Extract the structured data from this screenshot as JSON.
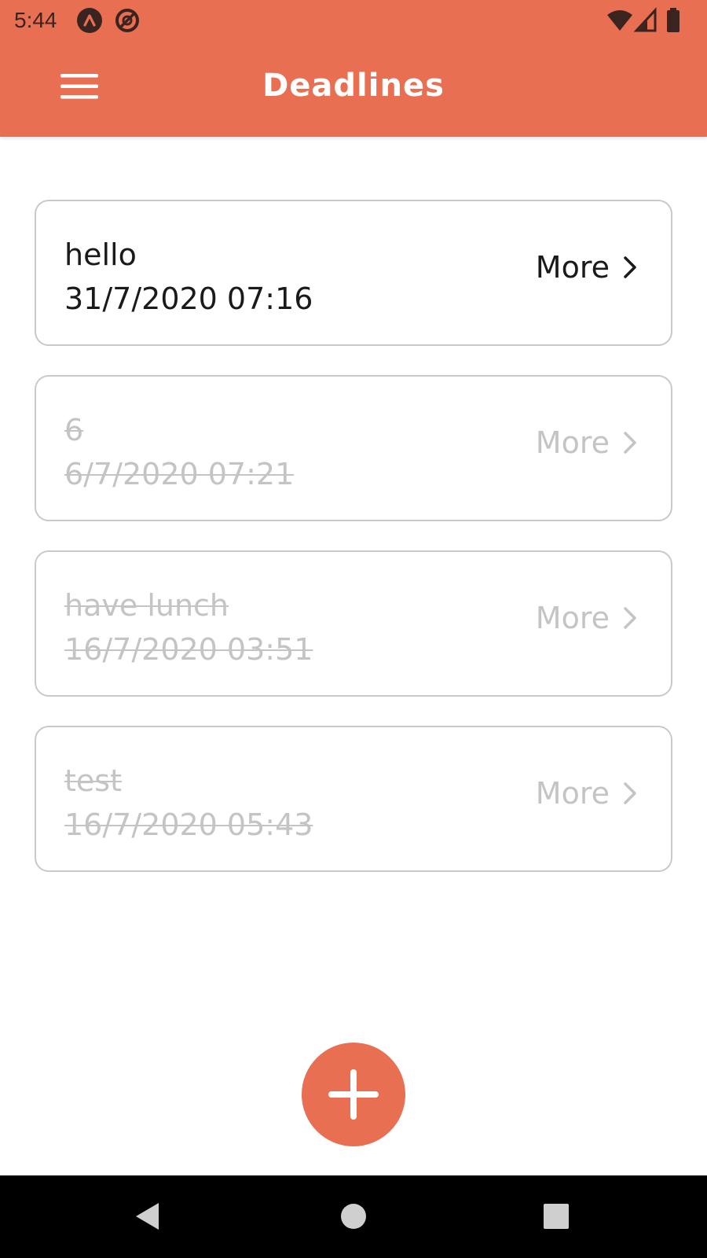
{
  "status_bar": {
    "time": "5:44",
    "left_icons": [
      "notification-app-icon",
      "notification-sync-icon"
    ],
    "right_icons": [
      "wifi-icon",
      "signal-icon",
      "battery-icon"
    ]
  },
  "app_bar": {
    "title": "Deadlines",
    "menu_icon": "hamburger-menu-icon"
  },
  "deadlines": [
    {
      "title": "hello",
      "date": "31/7/2020 07:16",
      "more_label": "More",
      "completed": false
    },
    {
      "title": "6",
      "date": "6/7/2020 07:21",
      "more_label": "More",
      "completed": true
    },
    {
      "title": "have lunch",
      "date": "16/7/2020 03:51",
      "more_label": "More",
      "completed": true
    },
    {
      "title": "test",
      "date": "16/7/2020 05:43",
      "more_label": "More",
      "completed": true
    }
  ],
  "fab": {
    "icon": "plus-icon"
  },
  "nav_bar": {
    "icons": [
      "back-icon",
      "home-icon",
      "recents-icon"
    ]
  },
  "colors": {
    "accent": "#e86f51",
    "text_active": "#1a1a1a",
    "text_completed": "#c4c4c4",
    "card_border": "#c9c9c9"
  }
}
